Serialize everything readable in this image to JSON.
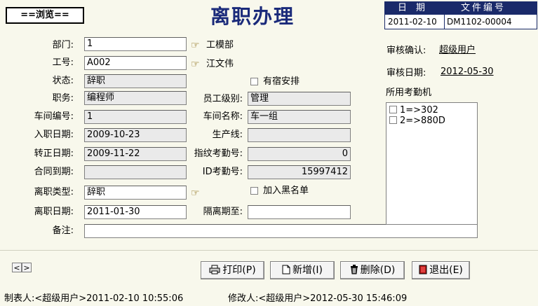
{
  "browse_label": "==浏览==",
  "title": "离职办理",
  "doc": {
    "head_date": "日　期",
    "head_file": "文件编号",
    "date": "2011-02-10",
    "file_no": "DM1102-00004"
  },
  "labels": {
    "dept": "部门:",
    "emp_no": "工号:",
    "status": "状态:",
    "position": "职务:",
    "emp_level": "员工级别:",
    "workshop_no": "车间编号:",
    "workshop_name": "车间名称:",
    "hire_date": "入职日期:",
    "production_line": "生产线:",
    "confirm_date": "转正日期:",
    "fp_attendance_no": "指纹考勤号:",
    "contract_expiry": "合同到期:",
    "id_attendance_no": "ID考勤号:",
    "leave_type": "离职类型:",
    "leave_date": "离职日期:",
    "isolation_until": "隔离期至:",
    "remark": "备注:",
    "review_confirm": "审核确认:",
    "review_date": "审核日期:",
    "attendance_machines": "所用考勤机"
  },
  "values": {
    "dept": "1",
    "dept_name": "工模部",
    "emp_no": "A002",
    "emp_name": "江文伟",
    "status": "辞职",
    "position": "编程师",
    "emp_level": "管理",
    "workshop_no": "1",
    "workshop_name": "车一组",
    "hire_date": "2009-10-23",
    "production_line": "",
    "confirm_date": "2009-11-22",
    "fp_attendance_no": "0",
    "contract_expiry": "",
    "id_attendance_no": "15997412",
    "leave_type": "辞职",
    "leave_date": "2011-01-30",
    "isolation_until": "",
    "remark": "",
    "review_confirm": "超级用户",
    "review_date": "2012-05-30"
  },
  "checkboxes": {
    "dorm": "有宿安排",
    "blacklist": "加入黑名单"
  },
  "machines": [
    "1=>302",
    "2=>880D"
  ],
  "nav": {
    "prev": "<",
    "next": ">"
  },
  "buttons": {
    "print": "打印(P)",
    "add": "新增(I)",
    "delete": "删除(D)",
    "exit": "退出(E)"
  },
  "footer": {
    "creator": "制表人:<超级用户>2011-02-10 10:55:06",
    "modifier": "修改人:<超级用户>2012-05-30 15:46:09"
  },
  "icons": {
    "lookup": "pointing-hand-icon",
    "print": "printer-icon",
    "add": "new-document-icon",
    "delete": "trash-icon",
    "exit": "exit-door-icon"
  },
  "colors": {
    "title": "#1a2a7a",
    "doc_header": "#1a2a6a",
    "background": "#f8f8ec",
    "exit_icon": "#b01818"
  }
}
